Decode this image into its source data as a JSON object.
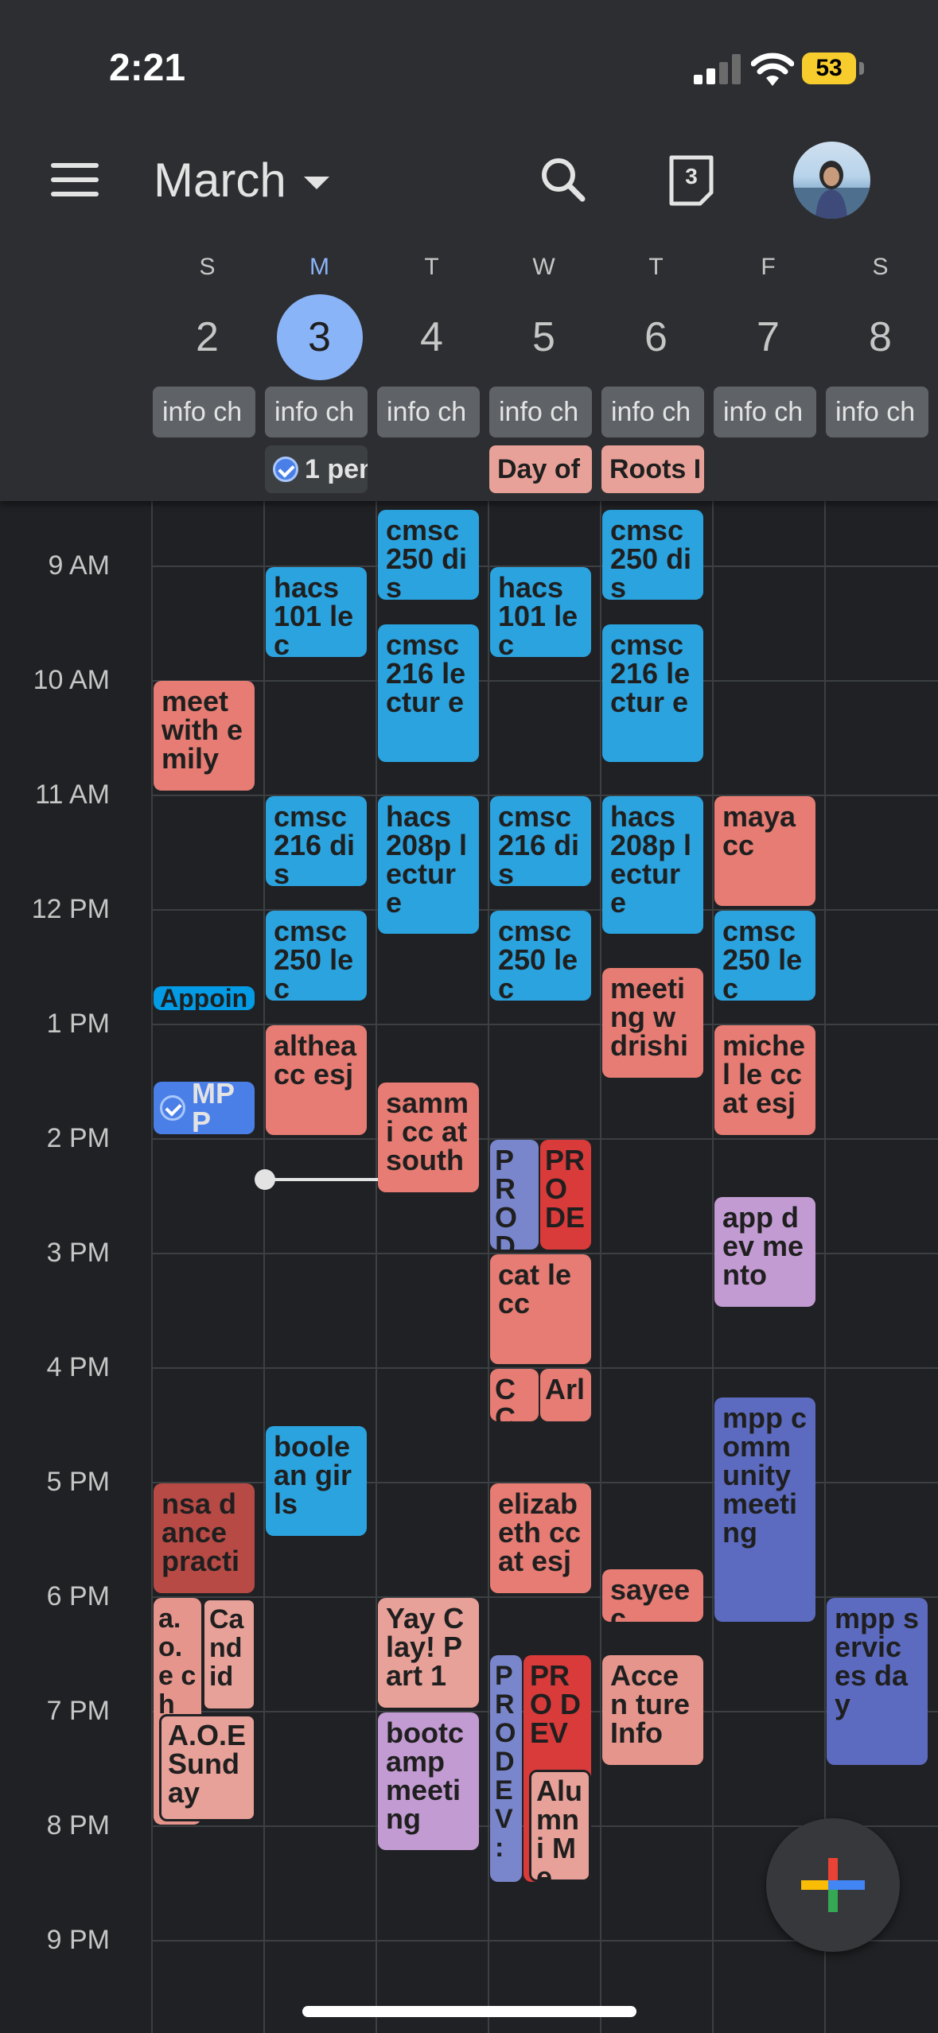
{
  "status_bar": {
    "time": "2:21",
    "battery": "53"
  },
  "header": {
    "month": "March",
    "today_number": "3"
  },
  "days": [
    {
      "dow": "S",
      "num": "2"
    },
    {
      "dow": "M",
      "num": "3"
    },
    {
      "dow": "T",
      "num": "4"
    },
    {
      "dow": "W",
      "num": "5"
    },
    {
      "dow": "T",
      "num": "6"
    },
    {
      "dow": "F",
      "num": "7"
    },
    {
      "dow": "S",
      "num": "8"
    }
  ],
  "all_day": {
    "info_chip": "info ch",
    "task_chip": "1 pen",
    "wed_event": "Day of",
    "thu_event": "Roots I"
  },
  "hours": [
    "9 AM",
    "10 AM",
    "11 AM",
    "12 PM",
    "1 PM",
    "2 PM",
    "3 PM",
    "4 PM",
    "5 PM",
    "6 PM",
    "7 PM",
    "8 PM",
    "9 PM"
  ],
  "events": {
    "meet_emily": "meet with emily",
    "appoin": "Appoin",
    "mpp_task": "MPP",
    "nsa_dance": "nsa dance practi",
    "aoe_ch": "a. o. e ch",
    "candid": "Ca nd id",
    "aoe_sunday": "A.O.E Sund ay",
    "hacs101_m": "hacs 101 lec",
    "cmsc216_dis_m": "cmsc 216 dis",
    "cmsc250_lec_m": "cmsc 250 lec",
    "althea": "althea cc esj",
    "boolean_girls": "boole an girls",
    "cmsc250_dis_t": "cmsc 250 dis",
    "cmsc216_lec_t": "cmsc 216 lectur e",
    "hacs208p_t": "hacs 208p lectur e",
    "sammi": "sammi cc at south",
    "yay_clay": "Yay Clay! Part 1",
    "bootcamp": "bootc amp meeti ng",
    "hacs101_w": "hacs 101 lec",
    "cmsc216_dis_w": "cmsc 216 dis",
    "cmsc250_lec_w": "cmsc 250 lec",
    "pro_de_1": "PR O DE",
    "pro_de_2": "PR O DE",
    "cat_le_cc": "cat le cc",
    "cc_w": "CC",
    "arl_w": "Arl",
    "elizabeth": "elizab eth cc at esj",
    "prodev_narrow": "P R O D E V :",
    "prodev_red": "PR O DEV",
    "alumni": "Alu mni Me",
    "cmsc250_dis_th": "cmsc 250 dis",
    "cmsc216_lec_th": "cmsc 216 lectur e",
    "hacs208p_th": "hacs 208p lectur e",
    "meeting_drishi": "meeti ng w drishi",
    "sayee": "sayee c",
    "accenture": "Accen ture Info",
    "maya_cc": "maya cc",
    "cmsc250_lec_f": "cmsc 250 lec",
    "michelle": "michel le cc at esj",
    "app_dev": "app dev mento",
    "mpp_community": "mpp comm unity meeti ng",
    "mpp_service": "mpp servic es day"
  },
  "colors": {
    "background": "#202124",
    "header": "#2d2e31",
    "today_accent": "#8ab4f8",
    "blue_event": "#039be5",
    "salmon_event": "#e67c73",
    "purple_event": "#5c6bc0",
    "lavender_event": "#c39bd3"
  }
}
